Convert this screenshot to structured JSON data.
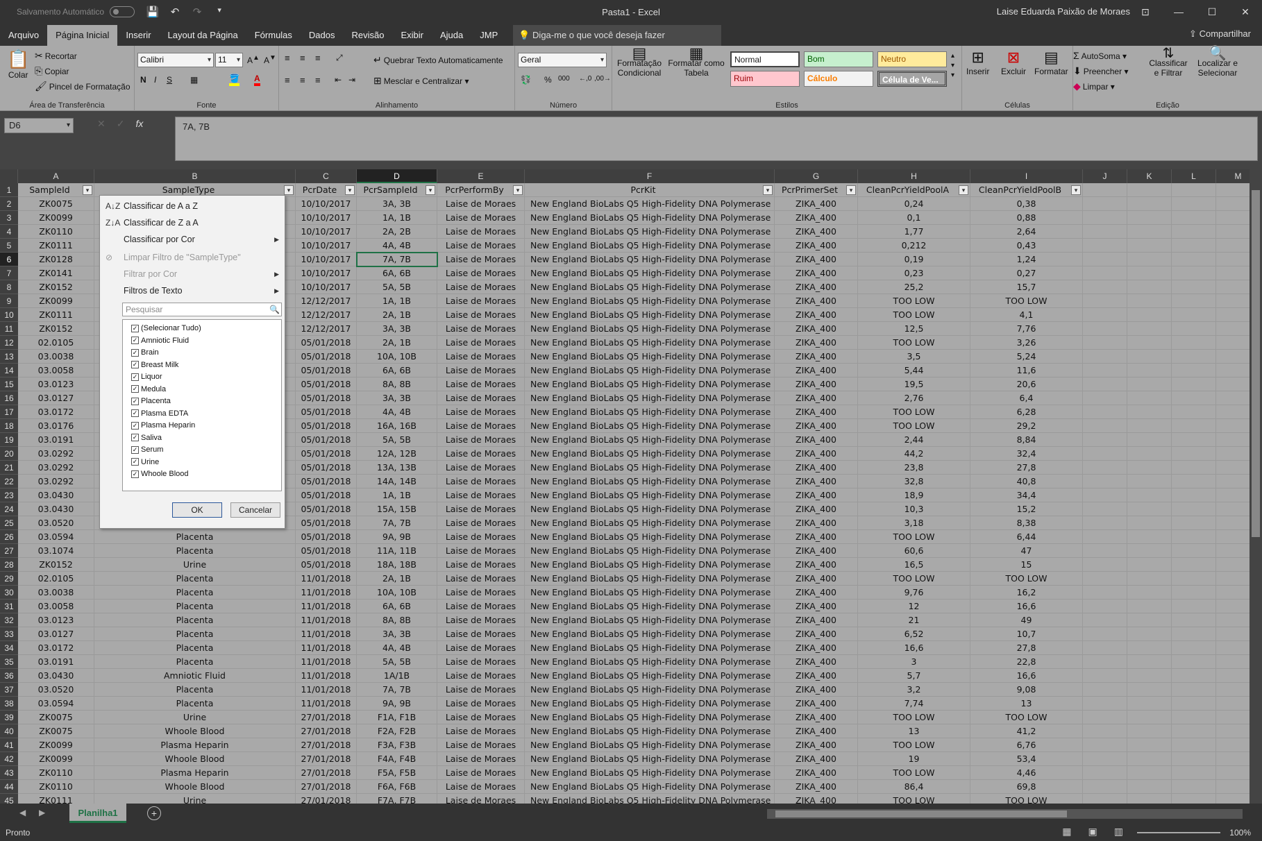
{
  "titlebar": {
    "autosave_label": "Salvamento Automático",
    "document_title": "Pasta1  -  Excel",
    "user_name": "Laise Eduarda Paixão de Moraes"
  },
  "menu": {
    "tabs": [
      "Arquivo",
      "Página Inicial",
      "Inserir",
      "Layout da Página",
      "Fórmulas",
      "Dados",
      "Revisão",
      "Exibir",
      "Ajuda",
      "JMP"
    ],
    "active_tab": "Página Inicial",
    "tell_me": "Diga-me o que você deseja fazer",
    "share": "Compartilhar"
  },
  "ribbon": {
    "clipboard": {
      "paste": "Colar",
      "cut": "Recortar",
      "copy": "Copiar",
      "format_painter": "Pincel de Formatação",
      "label": "Área de Transferência"
    },
    "font": {
      "name": "Calibri",
      "size": "11",
      "label": "Fonte"
    },
    "alignment": {
      "wrap": "Quebrar Texto Automaticamente",
      "merge": "Mesclar e Centralizar",
      "label": "Alinhamento"
    },
    "number": {
      "format": "Geral",
      "label": "Número"
    },
    "styles": {
      "conditional": "Formatação Condicional",
      "format_table": "Formatar como Tabela",
      "normal": "Normal",
      "bom": "Bom",
      "neutro": "Neutro",
      "ruim": "Ruim",
      "calculo": "Cálculo",
      "celula_ve": "Célula de Ve...",
      "label": "Estilos"
    },
    "cells": {
      "insert": "Inserir",
      "delete": "Excluir",
      "format": "Formatar",
      "label": "Células"
    },
    "editing": {
      "autosum": "AutoSoma",
      "fill": "Preencher",
      "clear": "Limpar",
      "sort_filter": "Classificar e Filtrar",
      "find_select": "Localizar e Selecionar",
      "label": "Edição"
    },
    "colors": {
      "bom_bg": "#c6efce",
      "bom_fg": "#006100",
      "neutro_bg": "#ffeb9c",
      "neutro_fg": "#9c5700",
      "ruim_bg": "#ffc7ce",
      "ruim_fg": "#9c0006",
      "calculo_fg": "#fa7d00",
      "celula_bg": "#a5a5a5"
    }
  },
  "formula_bar": {
    "name_box": "D6",
    "formula": "7A, 7B"
  },
  "columns": [
    "A",
    "B",
    "C",
    "D",
    "E",
    "F",
    "G",
    "H",
    "I",
    "J",
    "K",
    "L",
    "M"
  ],
  "selected_column": "D",
  "selected_row": "6",
  "headers": [
    "SampleId",
    "SampleType",
    "PcrDate",
    "PcrSampleId",
    "PcrPerformBy",
    "PcrKit",
    "PcrPrimerSet",
    "CleanPcrYieldPoolA",
    "CleanPcrYieldPoolB"
  ],
  "rows": [
    [
      "ZK0075",
      "",
      "10/10/2017",
      "3A, 3B",
      "Laise de Moraes",
      "New England BioLabs Q5 High-Fidelity DNA Polymerase",
      "ZIKA_400",
      "0,24",
      "0,38"
    ],
    [
      "ZK0099",
      "",
      "10/10/2017",
      "1A, 1B",
      "Laise de Moraes",
      "New England BioLabs Q5 High-Fidelity DNA Polymerase",
      "ZIKA_400",
      "0,1",
      "0,88"
    ],
    [
      "ZK0110",
      "",
      "10/10/2017",
      "2A, 2B",
      "Laise de Moraes",
      "New England BioLabs Q5 High-Fidelity DNA Polymerase",
      "ZIKA_400",
      "1,77",
      "2,64"
    ],
    [
      "ZK0111",
      "",
      "10/10/2017",
      "4A, 4B",
      "Laise de Moraes",
      "New England BioLabs Q5 High-Fidelity DNA Polymerase",
      "ZIKA_400",
      "0,212",
      "0,43"
    ],
    [
      "ZK0128",
      "",
      "10/10/2017",
      "7A, 7B",
      "Laise de Moraes",
      "New England BioLabs Q5 High-Fidelity DNA Polymerase",
      "ZIKA_400",
      "0,19",
      "1,24"
    ],
    [
      "ZK0141",
      "",
      "10/10/2017",
      "6A, 6B",
      "Laise de Moraes",
      "New England BioLabs Q5 High-Fidelity DNA Polymerase",
      "ZIKA_400",
      "0,23",
      "0,27"
    ],
    [
      "ZK0152",
      "",
      "10/10/2017",
      "5A, 5B",
      "Laise de Moraes",
      "New England BioLabs Q5 High-Fidelity DNA Polymerase",
      "ZIKA_400",
      "25,2",
      "15,7"
    ],
    [
      "ZK0099",
      "",
      "12/12/2017",
      "1A, 1B",
      "Laise de Moraes",
      "New England BioLabs Q5 High-Fidelity DNA Polymerase",
      "ZIKA_400",
      "TOO LOW",
      "TOO LOW"
    ],
    [
      "ZK0111",
      "",
      "12/12/2017",
      "2A, 1B",
      "Laise de Moraes",
      "New England BioLabs Q5 High-Fidelity DNA Polymerase",
      "ZIKA_400",
      "TOO LOW",
      "4,1"
    ],
    [
      "ZK0152",
      "",
      "12/12/2017",
      "3A, 3B",
      "Laise de Moraes",
      "New England BioLabs Q5 High-Fidelity DNA Polymerase",
      "ZIKA_400",
      "12,5",
      "7,76"
    ],
    [
      "02.0105",
      "",
      "05/01/2018",
      "2A, 1B",
      "Laise de Moraes",
      "New England BioLabs Q5 High-Fidelity DNA Polymerase",
      "ZIKA_400",
      "TOO LOW",
      "3,26"
    ],
    [
      "03.0038",
      "",
      "05/01/2018",
      "10A, 10B",
      "Laise de Moraes",
      "New England BioLabs Q5 High-Fidelity DNA Polymerase",
      "ZIKA_400",
      "3,5",
      "5,24"
    ],
    [
      "03.0058",
      "",
      "05/01/2018",
      "6A, 6B",
      "Laise de Moraes",
      "New England BioLabs Q5 High-Fidelity DNA Polymerase",
      "ZIKA_400",
      "5,44",
      "11,6"
    ],
    [
      "03.0123",
      "",
      "05/01/2018",
      "8A, 8B",
      "Laise de Moraes",
      "New England BioLabs Q5 High-Fidelity DNA Polymerase",
      "ZIKA_400",
      "19,5",
      "20,6"
    ],
    [
      "03.0127",
      "",
      "05/01/2018",
      "3A, 3B",
      "Laise de Moraes",
      "New England BioLabs Q5 High-Fidelity DNA Polymerase",
      "ZIKA_400",
      "2,76",
      "6,4"
    ],
    [
      "03.0172",
      "",
      "05/01/2018",
      "4A, 4B",
      "Laise de Moraes",
      "New England BioLabs Q5 High-Fidelity DNA Polymerase",
      "ZIKA_400",
      "TOO LOW",
      "6,28"
    ],
    [
      "03.0176",
      "",
      "05/01/2018",
      "16A, 16B",
      "Laise de Moraes",
      "New England BioLabs Q5 High-Fidelity DNA Polymerase",
      "ZIKA_400",
      "TOO LOW",
      "29,2"
    ],
    [
      "03.0191",
      "",
      "05/01/2018",
      "5A, 5B",
      "Laise de Moraes",
      "New England BioLabs Q5 High-Fidelity DNA Polymerase",
      "ZIKA_400",
      "2,44",
      "8,84"
    ],
    [
      "03.0292",
      "",
      "05/01/2018",
      "12A, 12B",
      "Laise de Moraes",
      "New England BioLabs Q5 High-Fidelity DNA Polymerase",
      "ZIKA_400",
      "44,2",
      "32,4"
    ],
    [
      "03.0292",
      "",
      "05/01/2018",
      "13A, 13B",
      "Laise de Moraes",
      "New England BioLabs Q5 High-Fidelity DNA Polymerase",
      "ZIKA_400",
      "23,8",
      "27,8"
    ],
    [
      "03.0292",
      "",
      "05/01/2018",
      "14A, 14B",
      "Laise de Moraes",
      "New England BioLabs Q5 High-Fidelity DNA Polymerase",
      "ZIKA_400",
      "32,8",
      "40,8"
    ],
    [
      "03.0430",
      "",
      "05/01/2018",
      "1A, 1B",
      "Laise de Moraes",
      "New England BioLabs Q5 High-Fidelity DNA Polymerase",
      "ZIKA_400",
      "18,9",
      "34,4"
    ],
    [
      "03.0430",
      "",
      "05/01/2018",
      "15A, 15B",
      "Laise de Moraes",
      "New England BioLabs Q5 High-Fidelity DNA Polymerase",
      "ZIKA_400",
      "10,3",
      "15,2"
    ],
    [
      "03.0520",
      "",
      "05/01/2018",
      "7A, 7B",
      "Laise de Moraes",
      "New England BioLabs Q5 High-Fidelity DNA Polymerase",
      "ZIKA_400",
      "3,18",
      "8,38"
    ],
    [
      "03.0594",
      "Placenta",
      "05/01/2018",
      "9A, 9B",
      "Laise de Moraes",
      "New England BioLabs Q5 High-Fidelity DNA Polymerase",
      "ZIKA_400",
      "TOO LOW",
      "6,44"
    ],
    [
      "03.1074",
      "Placenta",
      "05/01/2018",
      "11A, 11B",
      "Laise de Moraes",
      "New England BioLabs Q5 High-Fidelity DNA Polymerase",
      "ZIKA_400",
      "60,6",
      "47"
    ],
    [
      "ZK0152",
      "Urine",
      "05/01/2018",
      "18A, 18B",
      "Laise de Moraes",
      "New England BioLabs Q5 High-Fidelity DNA Polymerase",
      "ZIKA_400",
      "16,5",
      "15"
    ],
    [
      "02.0105",
      "Placenta",
      "11/01/2018",
      "2A, 1B",
      "Laise de Moraes",
      "New England BioLabs Q5 High-Fidelity DNA Polymerase",
      "ZIKA_400",
      "TOO LOW",
      "TOO LOW"
    ],
    [
      "03.0038",
      "Placenta",
      "11/01/2018",
      "10A, 10B",
      "Laise de Moraes",
      "New England BioLabs Q5 High-Fidelity DNA Polymerase",
      "ZIKA_400",
      "9,76",
      "16,2"
    ],
    [
      "03.0058",
      "Placenta",
      "11/01/2018",
      "6A, 6B",
      "Laise de Moraes",
      "New England BioLabs Q5 High-Fidelity DNA Polymerase",
      "ZIKA_400",
      "12",
      "16,6"
    ],
    [
      "03.0123",
      "Placenta",
      "11/01/2018",
      "8A, 8B",
      "Laise de Moraes",
      "New England BioLabs Q5 High-Fidelity DNA Polymerase",
      "ZIKA_400",
      "21",
      "49"
    ],
    [
      "03.0127",
      "Placenta",
      "11/01/2018",
      "3A, 3B",
      "Laise de Moraes",
      "New England BioLabs Q5 High-Fidelity DNA Polymerase",
      "ZIKA_400",
      "6,52",
      "10,7"
    ],
    [
      "03.0172",
      "Placenta",
      "11/01/2018",
      "4A, 4B",
      "Laise de Moraes",
      "New England BioLabs Q5 High-Fidelity DNA Polymerase",
      "ZIKA_400",
      "16,6",
      "27,8"
    ],
    [
      "03.0191",
      "Placenta",
      "11/01/2018",
      "5A, 5B",
      "Laise de Moraes",
      "New England BioLabs Q5 High-Fidelity DNA Polymerase",
      "ZIKA_400",
      "3",
      "22,8"
    ],
    [
      "03.0430",
      "Amniotic Fluid",
      "11/01/2018",
      "1A/1B",
      "Laise de Moraes",
      "New England BioLabs Q5 High-Fidelity DNA Polymerase",
      "ZIKA_400",
      "5,7",
      "16,6"
    ],
    [
      "03.0520",
      "Placenta",
      "11/01/2018",
      "7A, 7B",
      "Laise de Moraes",
      "New England BioLabs Q5 High-Fidelity DNA Polymerase",
      "ZIKA_400",
      "3,2",
      "9,08"
    ],
    [
      "03.0594",
      "Placenta",
      "11/01/2018",
      "9A, 9B",
      "Laise de Moraes",
      "New England BioLabs Q5 High-Fidelity DNA Polymerase",
      "ZIKA_400",
      "7,74",
      "13"
    ],
    [
      "ZK0075",
      "Urine",
      "27/01/2018",
      "F1A, F1B",
      "Laise de Moraes",
      "New England BioLabs Q5 High-Fidelity DNA Polymerase",
      "ZIKA_400",
      "TOO LOW",
      "TOO LOW"
    ],
    [
      "ZK0075",
      "Whoole Blood",
      "27/01/2018",
      "F2A, F2B",
      "Laise de Moraes",
      "New England BioLabs Q5 High-Fidelity DNA Polymerase",
      "ZIKA_400",
      "13",
      "41,2"
    ],
    [
      "ZK0099",
      "Plasma Heparin",
      "27/01/2018",
      "F3A, F3B",
      "Laise de Moraes",
      "New England BioLabs Q5 High-Fidelity DNA Polymerase",
      "ZIKA_400",
      "TOO LOW",
      "6,76"
    ],
    [
      "ZK0099",
      "Whoole Blood",
      "27/01/2018",
      "F4A, F4B",
      "Laise de Moraes",
      "New England BioLabs Q5 High-Fidelity DNA Polymerase",
      "ZIKA_400",
      "19",
      "53,4"
    ],
    [
      "ZK0110",
      "Plasma Heparin",
      "27/01/2018",
      "F5A, F5B",
      "Laise de Moraes",
      "New England BioLabs Q5 High-Fidelity DNA Polymerase",
      "ZIKA_400",
      "TOO LOW",
      "4,46"
    ],
    [
      "ZK0110",
      "Whoole Blood",
      "27/01/2018",
      "F6A, F6B",
      "Laise de Moraes",
      "New England BioLabs Q5 High-Fidelity DNA Polymerase",
      "ZIKA_400",
      "86,4",
      "69,8"
    ],
    [
      "ZK0111",
      "Urine",
      "27/01/2018",
      "F7A, F7B",
      "Laise de Moraes",
      "New England BioLabs Q5 High-Fidelity DNA Polymerase",
      "ZIKA_400",
      "TOO LOW",
      "TOO LOW"
    ]
  ],
  "filter_dropdown": {
    "sort_az": "Classificar de A a Z",
    "sort_za": "Classificar de Z a A",
    "sort_color": "Classificar por Cor",
    "clear_filter": "Limpar Filtro de \"SampleType\"",
    "filter_color": "Filtrar por Cor",
    "text_filters": "Filtros de Texto",
    "search_placeholder": "Pesquisar",
    "items": [
      "(Selecionar Tudo)",
      "Amniotic Fluid",
      "Brain",
      "Breast Milk",
      "Liquor",
      "Medula",
      "Placenta",
      "Plasma EDTA",
      "Plasma Heparin",
      "Saliva",
      "Serum",
      "Urine",
      "Whoole Blood"
    ],
    "ok": "OK",
    "cancel": "Cancelar"
  },
  "sheets": {
    "active": "Planilha1"
  },
  "status": {
    "text": "Pronto",
    "zoom": "100%"
  }
}
